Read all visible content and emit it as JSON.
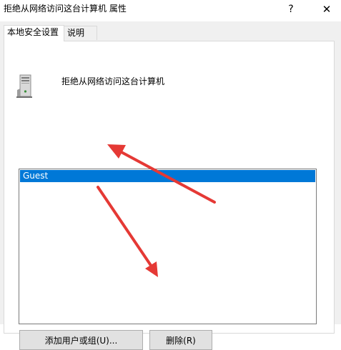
{
  "window": {
    "title": "拒绝从网络访问这台计算机 属性",
    "help_glyph": "?",
    "close_glyph": "✕"
  },
  "tabs": [
    {
      "label": "本地安全设置",
      "active": true
    },
    {
      "label": "说明",
      "active": false
    }
  ],
  "policy": {
    "icon": "computer-tower-icon",
    "title": "拒绝从网络访问这台计算机"
  },
  "users_list": {
    "items": [
      {
        "label": "Guest",
        "selected": true
      }
    ]
  },
  "buttons": {
    "add_label": "添加用户或组(U)...",
    "remove_label": "删除(R)"
  },
  "colors": {
    "selection": "#0078d7",
    "annotation_arrow": "#e53935",
    "dialog_bg": "#f0f0f0"
  }
}
